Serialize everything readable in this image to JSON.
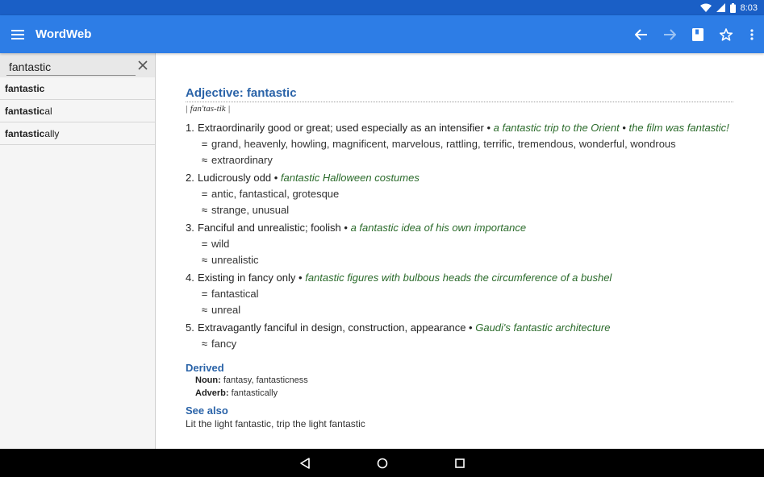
{
  "status_bar": {
    "time": "8:03"
  },
  "app_bar": {
    "title": "WordWeb"
  },
  "search": {
    "value": "fantastic"
  },
  "results": [
    {
      "bold": "fantastic",
      "rest": ""
    },
    {
      "bold": "fantastic",
      "rest": "al"
    },
    {
      "bold": "fantastic",
      "rest": "ally"
    }
  ],
  "entry": {
    "heading": "Adjective: fantastic",
    "pronunciation": "| fan'tas-tik |",
    "senses": [
      {
        "num": "1.",
        "definition": "Extraordinarily good or great; used especially as an intensifier",
        "examples": [
          "a fantastic trip to the Orient",
          "the film was fantastic!"
        ],
        "synonyms": "grand, heavenly, howling, magnificent, marvelous, rattling, terrific, tremendous, wonderful, wondrous",
        "similar": "extraordinary"
      },
      {
        "num": "2.",
        "definition": "Ludicrously odd",
        "examples": [
          "fantastic Halloween costumes"
        ],
        "synonyms": "antic, fantastical, grotesque",
        "similar": "strange, unusual"
      },
      {
        "num": "3.",
        "definition": "Fanciful and unrealistic; foolish",
        "examples": [
          "a fantastic idea of his own importance"
        ],
        "synonyms": "wild",
        "similar": "unrealistic"
      },
      {
        "num": "4.",
        "definition": "Existing in fancy only",
        "examples": [
          "fantastic figures with bulbous heads the circumference of a bushel"
        ],
        "synonyms": "fantastical",
        "similar": "unreal"
      },
      {
        "num": "5.",
        "definition": "Extravagantly fanciful in design, construction, appearance",
        "examples": [
          "Gaudi's fantastic architecture"
        ],
        "synonyms": "",
        "similar": "fancy"
      }
    ],
    "derived_heading": "Derived",
    "derived": [
      {
        "label": "Noun:",
        "words": "fantasy, fantasticness"
      },
      {
        "label": "Adverb:",
        "words": "fantastically"
      }
    ],
    "see_also_heading": "See also",
    "see_also_text": "Lit the light fantastic, trip the light fantastic"
  },
  "symbols": {
    "synonym": "=",
    "similar": "≈",
    "bullet": "•"
  },
  "colors": {
    "app_bar": "#2d7de6",
    "status_bar": "#1a5fc6",
    "heading": "#2a63a8",
    "example": "#2a6a2a"
  }
}
